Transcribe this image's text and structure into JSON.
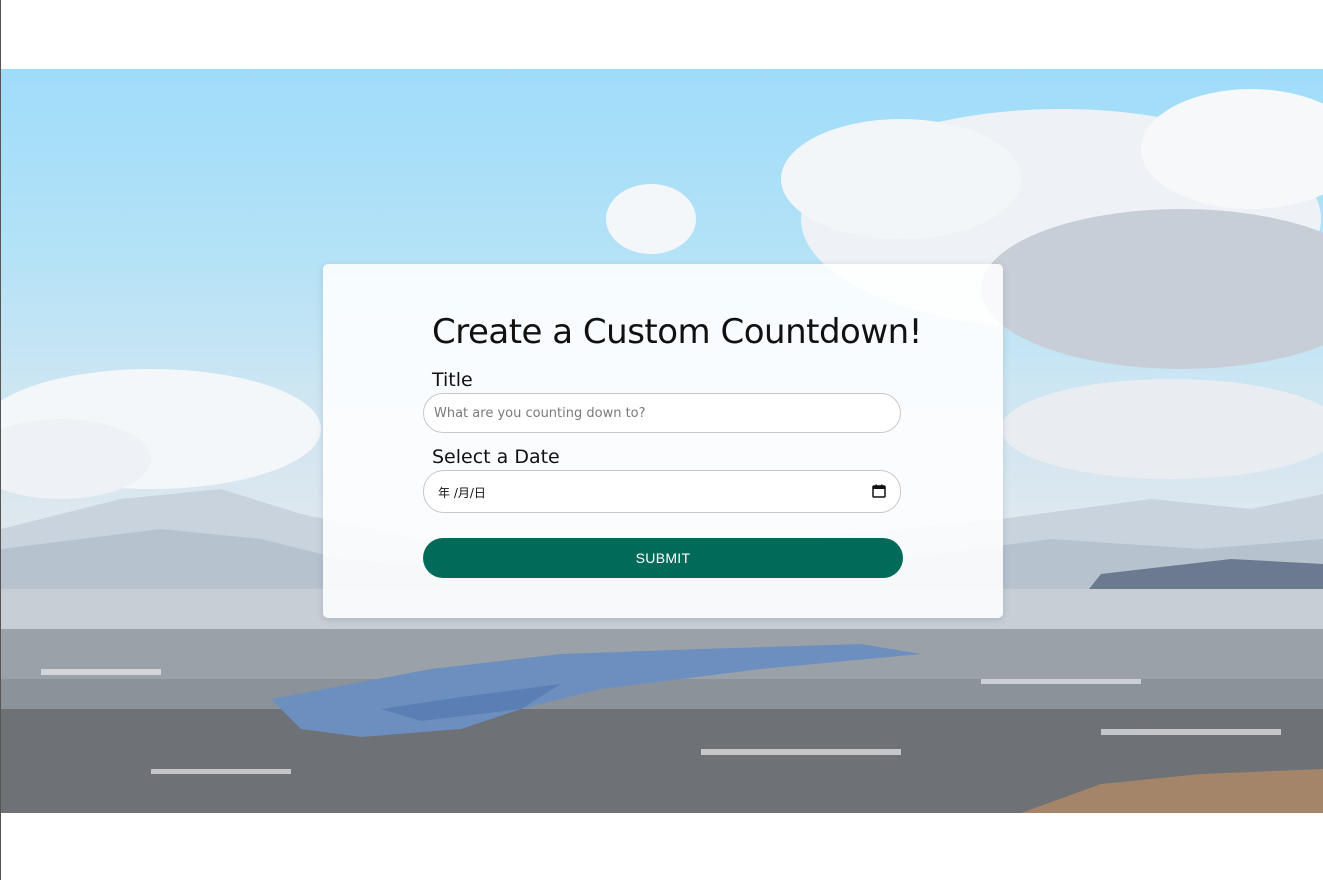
{
  "form": {
    "heading": "Create a Custom Countdown!",
    "title_label": "Title",
    "title_placeholder": "What are you counting down to?",
    "title_value": "",
    "date_label": "Select a Date",
    "date_display": "年 /月/日",
    "submit_label": "SUBMIT"
  },
  "icons": {
    "date_picker": "calendar-icon"
  },
  "colors": {
    "submit_button": "#016a58",
    "card_background": "#ffffff",
    "sky": "#9fdcf9"
  }
}
